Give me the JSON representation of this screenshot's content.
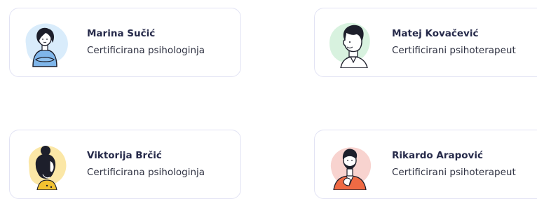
{
  "therapists": [
    {
      "name": "Marina Sučić",
      "role": "Certificirana psihologinja",
      "avatar_icon": "woman-arms-crossed-avatar",
      "accent": "#d9ecfb"
    },
    {
      "name": "Matej Kovačević",
      "role": "Certificirani psihoterapeut",
      "avatar_icon": "man-smiling-avatar",
      "accent": "#d8f2df"
    },
    {
      "name": "Viktorija Brčić",
      "role": "Certificirana psihologinja",
      "avatar_icon": "woman-hair-bun-avatar",
      "accent": "#fbe7a6"
    },
    {
      "name": "Rikardo Arapović",
      "role": "Certificirani psihoterapeut",
      "avatar_icon": "bearded-man-avatar",
      "accent": "#f8d3cf"
    }
  ]
}
